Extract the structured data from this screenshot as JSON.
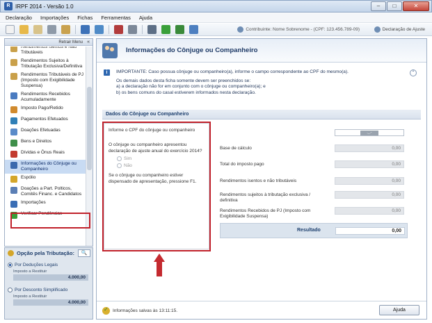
{
  "window": {
    "title": "IRPF 2014 - Versão 1.0",
    "minimize": "–",
    "maximize": "□",
    "close": "✕"
  },
  "menu": [
    "Declaração",
    "Importações",
    "Fichas",
    "Ferramentas",
    "Ajuda"
  ],
  "toolbar": {
    "contribuinte": "Contribuinte: Nome Sobrenome - (CPF: 123.456.789-09)",
    "declaracao": "Declaração de Ajuste"
  },
  "sidebar": {
    "retrair": "Retrair Menu",
    "items": [
      {
        "label": "Rendimentos Isentos e Não Tributáveis",
        "color": "#c9a04a"
      },
      {
        "label": "Rendimentos Sujeitos à Tributação Exclusiva/Definitiva",
        "color": "#c9a04a"
      },
      {
        "label": "Rendimentos Tributáveis de PJ (Imposto com Exigibilidade Suspensa)",
        "color": "#c9a04a"
      },
      {
        "label": "Rendimentos Recebidos Acumuladamente",
        "color": "#4a7bc0"
      },
      {
        "label": "Imposto Pago/Retido",
        "color": "#d08a2e"
      },
      {
        "label": "Pagamentos Efetuados",
        "color": "#2f7fb7"
      },
      {
        "label": "Doações Efetuadas",
        "color": "#5a8bc9"
      },
      {
        "label": "Bens e Direitos",
        "color": "#3f8f4a"
      },
      {
        "label": "Dívidas e Ônus Reais",
        "color": "#c23a2f"
      },
      {
        "label": "Informações do Cônjuge ou Companheiro",
        "color": "#3a69ad"
      },
      {
        "label": "Espólio",
        "color": "#d4a62a"
      },
      {
        "label": "Doações a Part. Polticos, Comitês Financ. e Candidatos",
        "color": "#5b7fb5"
      },
      {
        "label": "Importações",
        "color": "#3a6eb5"
      },
      {
        "label": "Verificar Pendências",
        "color": "#3aa03a"
      }
    ]
  },
  "tributacao": {
    "title": "Opção pela Tributação:",
    "search": "🔍",
    "options": [
      {
        "label": "Por Deduções Legais",
        "imposto_label": "Imposto a Restituir",
        "imposto_value": "4.000,00"
      },
      {
        "label": "Por Desconto Simplificado",
        "imposto_label": "Imposto a Restituir",
        "imposto_value": "4.000,00"
      }
    ]
  },
  "page": {
    "title": "Informações do Cônjuge ou Companheiro",
    "notice_line1": "IMPORTANTE: Caso possua cônjuge ou companheiro(a), informe o campo correspondente ao CPF do mesmo(a).",
    "notice_line2": "Os demais dados desta ficha somente devem ser preenchidos se:",
    "notice_line3": "a) a declaração não for em conjunto com o cônjuge ou companheiro(a); e",
    "notice_line4": "b) os bens comuns do casal estiverem informados nesta declaração.",
    "info_icon": "i",
    "collapse_icon": "⌃",
    "section_title": "Dados do Cônjuge ou Companheiro",
    "cpf_label": "Informe o CPF do cônjuge ou companheiro",
    "question": "O cônjuge ou companheiro apresentou declaração de ajuste anual do exercício 2014?",
    "sim": "Sim",
    "nao": "Não",
    "hint": "Se o cônjuge ou companheiro estiver dispensado de apresentação, pressione F1.",
    "rows": [
      {
        "label": "Base de cálculo",
        "value": "0,00"
      },
      {
        "label": "Total do imposto pago",
        "value": "0,00"
      },
      {
        "label": "Rendimentos isentos e não tributáveis",
        "value": "0,00"
      },
      {
        "label": "Rendimentos sujeitos à tributação exclusiva / definitiva",
        "value": "0,00"
      },
      {
        "label": "Rendimentos Recebidos de PJ (Imposto com Exigibilidade Suspensa)",
        "value": "0,00"
      }
    ],
    "resultado_label": "Resultado",
    "resultado_value": "0,00",
    "saved": "Informações salvas às 13:11:15.",
    "ajuda": "Ajuda"
  }
}
